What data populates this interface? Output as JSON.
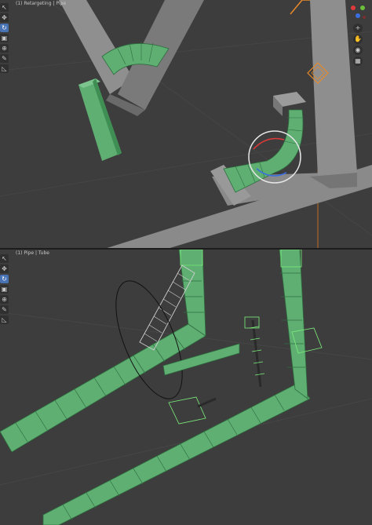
{
  "top_viewport": {
    "label": "(1) Retargeting | Pipe",
    "tools": [
      {
        "icon": "tweak-icon",
        "glyph": "↖",
        "active": false
      },
      {
        "icon": "move-icon",
        "glyph": "✥",
        "active": false
      },
      {
        "icon": "rotate-icon",
        "glyph": "↻",
        "active": true
      },
      {
        "icon": "scale-icon",
        "glyph": "▣",
        "active": false
      },
      {
        "icon": "transform-icon",
        "glyph": "⊕",
        "active": false
      },
      {
        "icon": "annotate-icon",
        "glyph": "✎",
        "active": false
      },
      {
        "icon": "measure-icon",
        "glyph": "◺",
        "active": false
      }
    ],
    "nav": [
      {
        "icon": "zoom-icon",
        "glyph": "+"
      },
      {
        "icon": "pan-hand-icon",
        "glyph": "✋"
      },
      {
        "icon": "camera-icon",
        "glyph": "◉"
      },
      {
        "icon": "grid-icon",
        "glyph": "▦"
      }
    ]
  },
  "bottom_viewport": {
    "label": "(1) Pipe | Tube",
    "tools": [
      {
        "icon": "tweak-icon",
        "glyph": "↖",
        "active": false
      },
      {
        "icon": "move-icon",
        "glyph": "✥",
        "active": false
      },
      {
        "icon": "rotate-icon",
        "glyph": "↻",
        "active": true
      },
      {
        "icon": "scale-icon",
        "glyph": "▣",
        "active": false
      },
      {
        "icon": "transform-icon",
        "glyph": "⊕",
        "active": false
      },
      {
        "icon": "annotate-icon",
        "glyph": "✎",
        "active": false
      },
      {
        "icon": "measure-icon",
        "glyph": "◺",
        "active": false
      }
    ]
  },
  "colors": {
    "mesh_green": "#5faf73",
    "mesh_green_dark": "#3f8f55",
    "wire": "#7cf07c",
    "gray_mesh": "#8c8c8c",
    "accent_orange": "#e8892a",
    "active_tool": "#4772b3"
  }
}
